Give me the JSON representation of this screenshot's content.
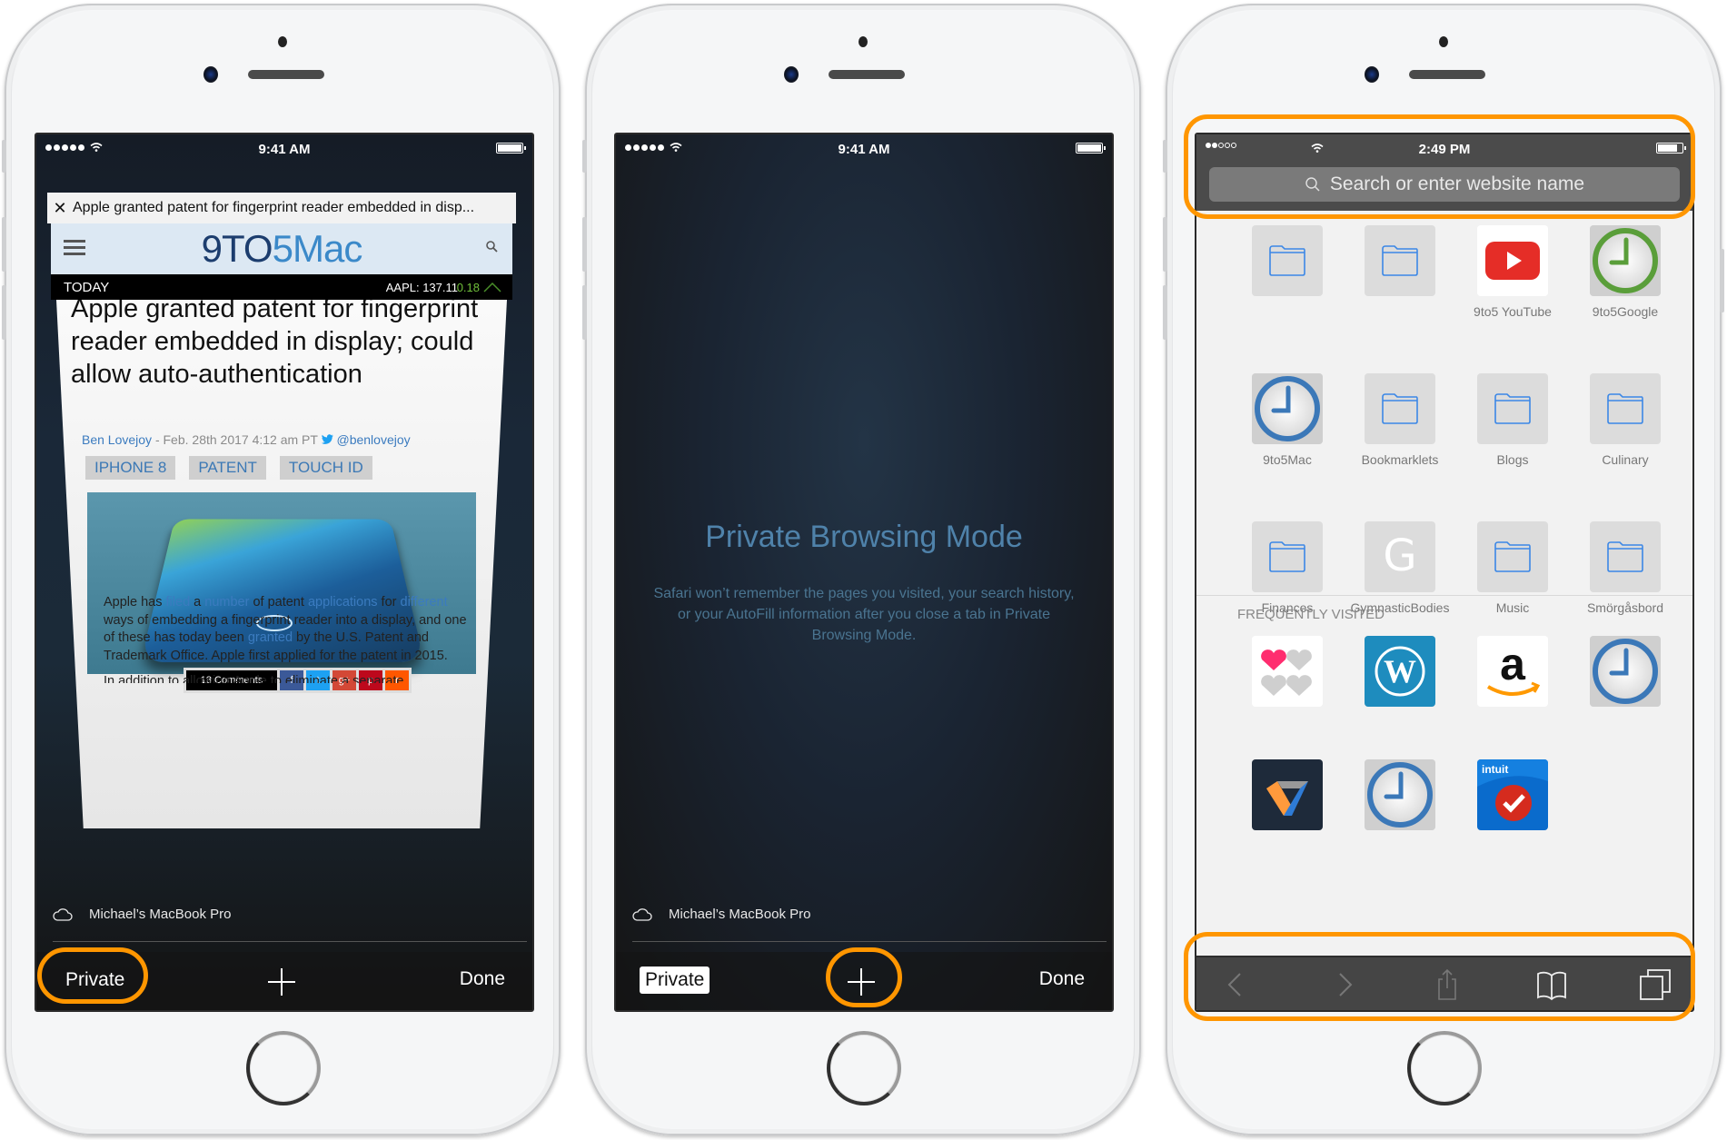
{
  "colors": {
    "highlight": "#ff9600",
    "link": "#3b7bbf",
    "private_title": "#4f82aa"
  },
  "phones": [
    {
      "status": {
        "time": "9:41 AM",
        "signal_bars": 5,
        "signal_bars_on": 5
      },
      "tab": {
        "close_icon": "close-icon",
        "title": "Apple granted patent for fingerprint reader embedded in disp...",
        "site": {
          "logo_part1": "9TO",
          "logo_part2": "5Mac",
          "ticker_label": "TODAY",
          "ticker_symbol": "AAPL: 137.11",
          "ticker_change": "0.18"
        },
        "headline": "Apple granted patent for fingerprint reader embedded in display; could allow auto-authentication",
        "byline": {
          "author": "Ben Lovejoy",
          "date": " - Feb. 28th 2017 4:12 am PT ",
          "twitter": "@benlovejoy"
        },
        "tags": [
          "IPHONE 8",
          "PATENT",
          "TOUCH ID"
        ],
        "share": {
          "comments": "18 Comments",
          "facebook": "f",
          "twitter": "t",
          "googleplus": "g+",
          "pinterest": "p",
          "reddit": "r"
        },
        "body": {
          "t1": "Apple has ",
          "l1": "filed",
          "t2": " a ",
          "l2": "number",
          "t3": " of patent ",
          "l3": "applications",
          "t4": " for ",
          "l4": "different",
          "t5": " ways of embedding a fingerprint reader into a display, and one of these has today been ",
          "l5": "granted",
          "t6": " by the U.S. Patent and Trademark Office. Apple first applied for the patent in 2015.",
          "cut": "In addition to allowing Apple to eliminate a separate"
        }
      },
      "cloud_device": "Michael’s MacBook Pro",
      "toolbar": {
        "private_label": "Private",
        "new_tab_icon": "plus-icon",
        "done_label": "Done"
      }
    },
    {
      "status": {
        "time": "9:41 AM"
      },
      "private_mode": {
        "title": "Private Browsing Mode",
        "description": "Safari won’t remember the pages you visited, your search history, or your AutoFill information after you close a tab in Private Browsing Mode."
      },
      "cloud_device": "Michael’s MacBook Pro",
      "toolbar": {
        "private_label": "Private",
        "new_tab_icon": "plus-icon",
        "done_label": "Done"
      }
    },
    {
      "status": {
        "time": "2:49 PM",
        "signal_bars_on": 2,
        "signal_bars": 5
      },
      "search": {
        "placeholder": "Search or enter website name"
      },
      "favorites": [
        {
          "label": "",
          "icon": "folder"
        },
        {
          "label": "",
          "icon": "folder"
        },
        {
          "label": "9to5 YouTube",
          "icon": "youtube"
        },
        {
          "label": "9to5Google",
          "icon": "clock-green"
        },
        {
          "label": "9to5Mac",
          "icon": "clock-blue"
        },
        {
          "label": "Bookmarklets",
          "icon": "folder"
        },
        {
          "label": "Blogs",
          "icon": "folder"
        },
        {
          "label": "Culinary",
          "icon": "folder"
        },
        {
          "label": "Finances",
          "icon": "folder"
        },
        {
          "label": "GymnasticBodies",
          "icon": "letter",
          "letter": "G"
        },
        {
          "label": "Music",
          "icon": "folder"
        },
        {
          "label": "Smörgåsbord",
          "icon": "folder"
        }
      ],
      "frequently_visited_heading": "FREQUENTLY VISITED",
      "frequently_visited": [
        {
          "icon": "hearts"
        },
        {
          "icon": "wordpress"
        },
        {
          "icon": "amazon"
        },
        {
          "icon": "clock-blue"
        },
        {
          "icon": "veeam"
        },
        {
          "icon": "clock-blue"
        },
        {
          "icon": "intuit",
          "badge": "intuit"
        }
      ],
      "bottom_toolbar": [
        "back-icon",
        "forward-icon",
        "share-icon",
        "bookmarks-icon",
        "tabs-icon"
      ]
    }
  ]
}
